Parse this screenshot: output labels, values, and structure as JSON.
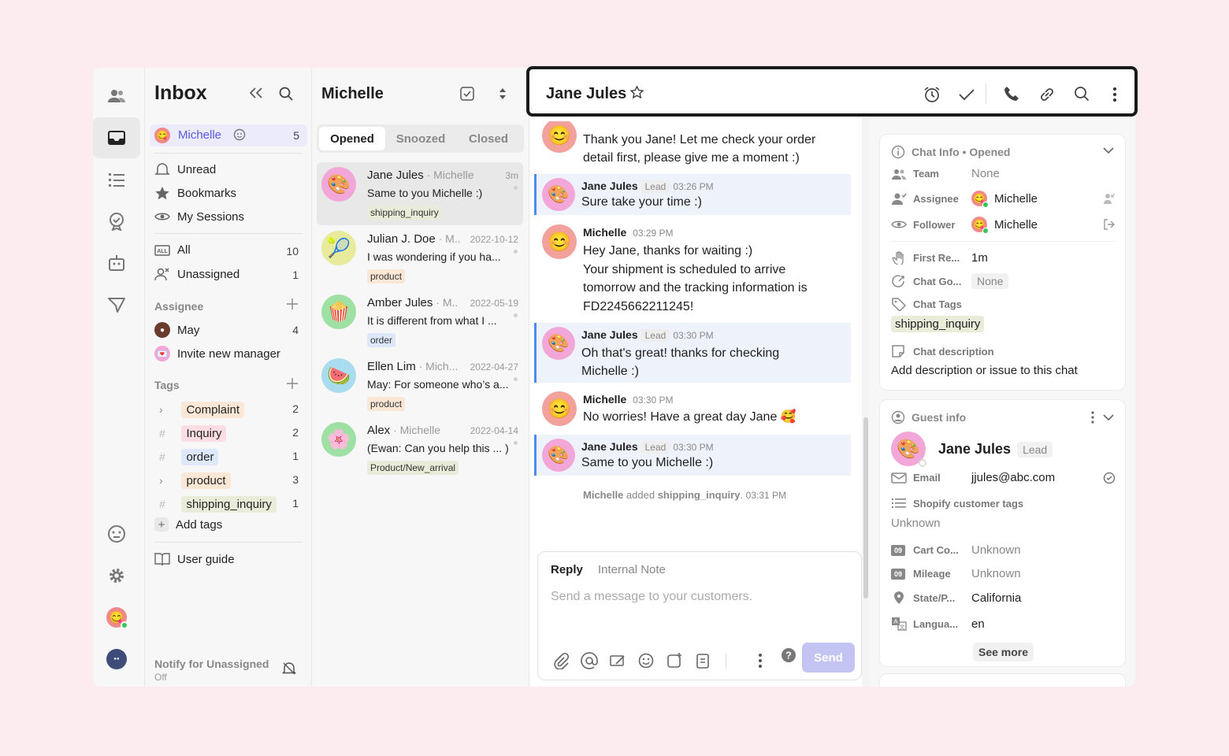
{
  "nav": {
    "title": "Inbox",
    "current_user": {
      "name": "Michelle",
      "count": "5"
    },
    "items": [
      {
        "label": "Unread"
      },
      {
        "label": "Bookmarks"
      },
      {
        "label": "My Sessions"
      }
    ],
    "all": {
      "label": "All",
      "count": "10"
    },
    "unassigned": {
      "label": "Unassigned",
      "count": "1"
    },
    "assignee_header": "Assignee",
    "assignees": [
      {
        "label": "May",
        "count": "4"
      }
    ],
    "invite_label": "Invite new manager",
    "tags_header": "Tags",
    "tags": [
      {
        "label": "Complaint",
        "count": "2",
        "color": "#fbe7d6"
      },
      {
        "label": "Inquiry",
        "count": "2",
        "color": "#fbdde3"
      },
      {
        "label": "order",
        "count": "1",
        "color": "#dde8fa"
      },
      {
        "label": "product",
        "count": "3",
        "color": "#fbe7d6"
      },
      {
        "label": "shipping_inquiry",
        "count": "1",
        "color": "#e8ecd9"
      }
    ],
    "add_tags": "Add tags",
    "user_guide": "User guide",
    "notify": {
      "label": "Notify for Unassigned",
      "status": "Off"
    }
  },
  "list": {
    "title": "Michelle",
    "tabs": [
      {
        "label": "Opened"
      },
      {
        "label": "Snoozed"
      },
      {
        "label": "Closed"
      }
    ],
    "conversations": [
      {
        "name": "Jane Jules",
        "agent": "Michelle",
        "time": "3m",
        "preview": "Same to you Michelle :)",
        "tag": "shipping_inquiry",
        "tag_color": "#e8ecd9",
        "avatar_bg": "#f2a7d8",
        "emoji": "🎨"
      },
      {
        "name": "Julian J. Doe",
        "agent": "M..",
        "time": "2022-10-12",
        "preview": "I was wondering if you ha...",
        "tag": "product",
        "tag_color": "#fbe7d6",
        "avatar_bg": "#e8ea9c",
        "emoji": "🎾"
      },
      {
        "name": "Amber Jules",
        "agent": "M..",
        "time": "2022-05-19",
        "preview": "It is different from what I ...",
        "tag": "order",
        "tag_color": "#dde8fa",
        "avatar_bg": "#9fe0a4",
        "emoji": "🍿"
      },
      {
        "name": "Ellen Lim",
        "agent": "Mich...",
        "time": "2022-04-27",
        "preview": "May: For someone who’s a...",
        "tag": "product",
        "tag_color": "#fbe7d6",
        "avatar_bg": "#a9dcef",
        "emoji": "🍉"
      },
      {
        "name": "Alex",
        "agent": "Michelle",
        "time": "2022-04-14",
        "preview": "(Ewan: Can you help this ... )",
        "tag": "Product/New_arrival",
        "tag_color": "#e8ecd9",
        "avatar_bg": "#9fe0a4",
        "emoji": "🌸"
      }
    ]
  },
  "chat": {
    "title": "Jane Jules",
    "messages": [
      {
        "text1": "Thank you Jane! Let me check your order",
        "text2": "detail first, please give me a moment :)"
      },
      {
        "sender": "Jane Jules",
        "badge": "Lead",
        "time": "03:26 PM",
        "text": "Sure take your time :)"
      },
      {
        "sender": "Michelle",
        "time": "03:29 PM",
        "l1": "Hey Jane, thanks for waiting :)",
        "l2": "Your shipment is scheduled to arrive",
        "l3": "tomorrow and the tracking information is",
        "l4": "FD2245662211245!"
      },
      {
        "sender": "Jane Jules",
        "badge": "Lead",
        "time": "03:30 PM",
        "l1": "Oh that's great! thanks for checking",
        "l2": "Michelle :)"
      },
      {
        "sender": "Michelle",
        "time": "03:30 PM",
        "text": "No worries! Have a great day Jane 🥰"
      },
      {
        "sender": "Jane Jules",
        "badge": "Lead",
        "time": "03:30 PM",
        "text": "Same to you Michelle :)"
      }
    ],
    "system": {
      "actor": "Michelle",
      "action": "added",
      "tag": "shipping_inquiry",
      "time": "03:31 PM"
    },
    "composer": {
      "tab_reply": "Reply",
      "tab_note": "Internal Note",
      "placeholder": "Send a message to your customers.",
      "send": "Send"
    }
  },
  "info": {
    "chat_info": {
      "header": "Chat Info • Opened",
      "team_label": "Team",
      "team_value": "None",
      "assignee_label": "Assignee",
      "assignee_value": "Michelle",
      "follower_label": "Follower",
      "follower_value": "Michelle",
      "first_label": "First Re...",
      "first_value": "1m",
      "goal_label": "Chat Go...",
      "goal_value": "None",
      "tags_label": "Chat Tags",
      "tag": "shipping_inquiry",
      "desc_label": "Chat description",
      "desc_value": "Add description or issue to this chat"
    },
    "guest": {
      "header": "Guest info",
      "name": "Jane Jules",
      "badge": "Lead",
      "email_label": "Email",
      "email": "jjules@abc.com",
      "shopify_label": "Shopify customer tags",
      "shopify_value": "Unknown",
      "cart_label": "Cart Co...",
      "cart_value": "Unknown",
      "mileage_label": "Mileage",
      "mileage_value": "Unknown",
      "state_label": "State/P...",
      "state_value": "California",
      "lang_label": "Langua...",
      "lang_value": "en",
      "see_more": "See more"
    }
  },
  "colors": {
    "accent": "#5b5bd6",
    "lead_bar": "#4d8af0",
    "send_disabled": "#c4c4f2"
  }
}
